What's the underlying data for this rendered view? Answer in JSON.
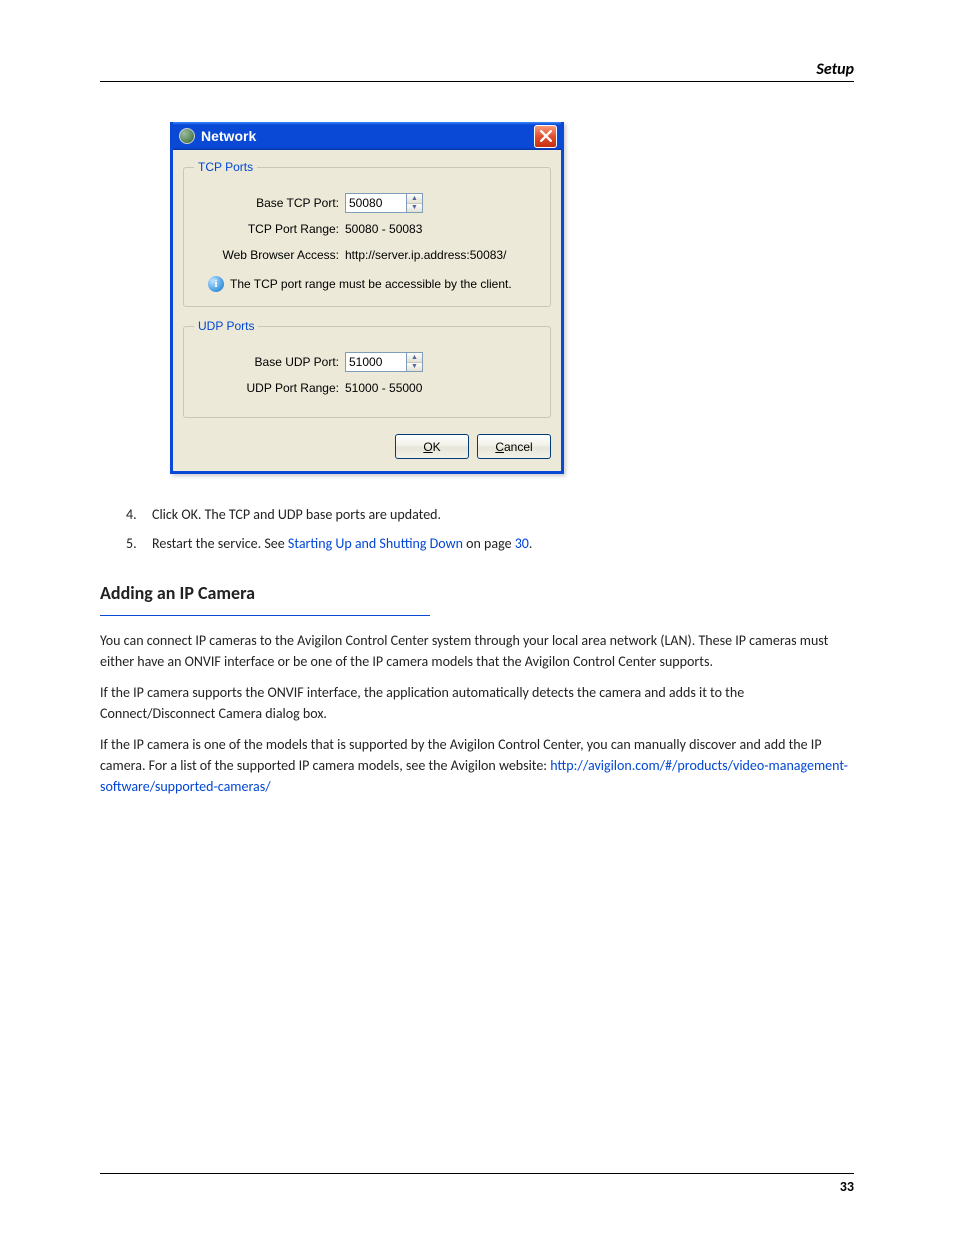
{
  "header": {
    "section": "Setup"
  },
  "footer": {
    "page_number": "33"
  },
  "dialog": {
    "title": "Network",
    "groups": {
      "tcp": {
        "legend": "TCP Ports",
        "base_label": "Base TCP Port:",
        "base_value": "50080",
        "range_label": "TCP Port Range:",
        "range_value": "50080 - 50083",
        "web_label": "Web Browser Access:",
        "web_value": "http://server.ip.address:50083/",
        "info": "The TCP port range must be accessible by the client."
      },
      "udp": {
        "legend": "UDP Ports",
        "base_label": "Base UDP Port:",
        "base_value": "51000",
        "range_label": "UDP Port Range:",
        "range_value": "51000 - 55000"
      }
    },
    "buttons": {
      "ok": "OK",
      "cancel": "Cancel"
    }
  },
  "body": {
    "step4_num": "4.",
    "step4_text": "Click OK. The TCP and UDP base ports are updated.",
    "step5_num": "5.",
    "step5_text_a": "Restart the service. See ",
    "step5_link": "Starting Up and Shutting Down",
    "step5_text_b": " on page ",
    "step5_page": "30",
    "step5_text_c": ".",
    "section_title": "Adding an IP Camera",
    "para1": "You can connect IP cameras to the Avigilon Control Center system through your local area network (LAN). These IP cameras must either have an ONVIF interface or be one of the IP camera models that the Avigilon Control Center supports.",
    "para2": "If the IP camera supports the ONVIF interface, the application automatically detects the camera and adds it to the Connect/Disconnect Camera dialog box.",
    "para3_a": "If the IP camera is one of the models that is supported by the Avigilon Control Center, you can manually discover and add the IP camera. For a list of the supported IP camera models, see the Avigilon website: ",
    "para3_link": "http://avigilon.com/#/products/video-management-software/supported-cameras/"
  }
}
